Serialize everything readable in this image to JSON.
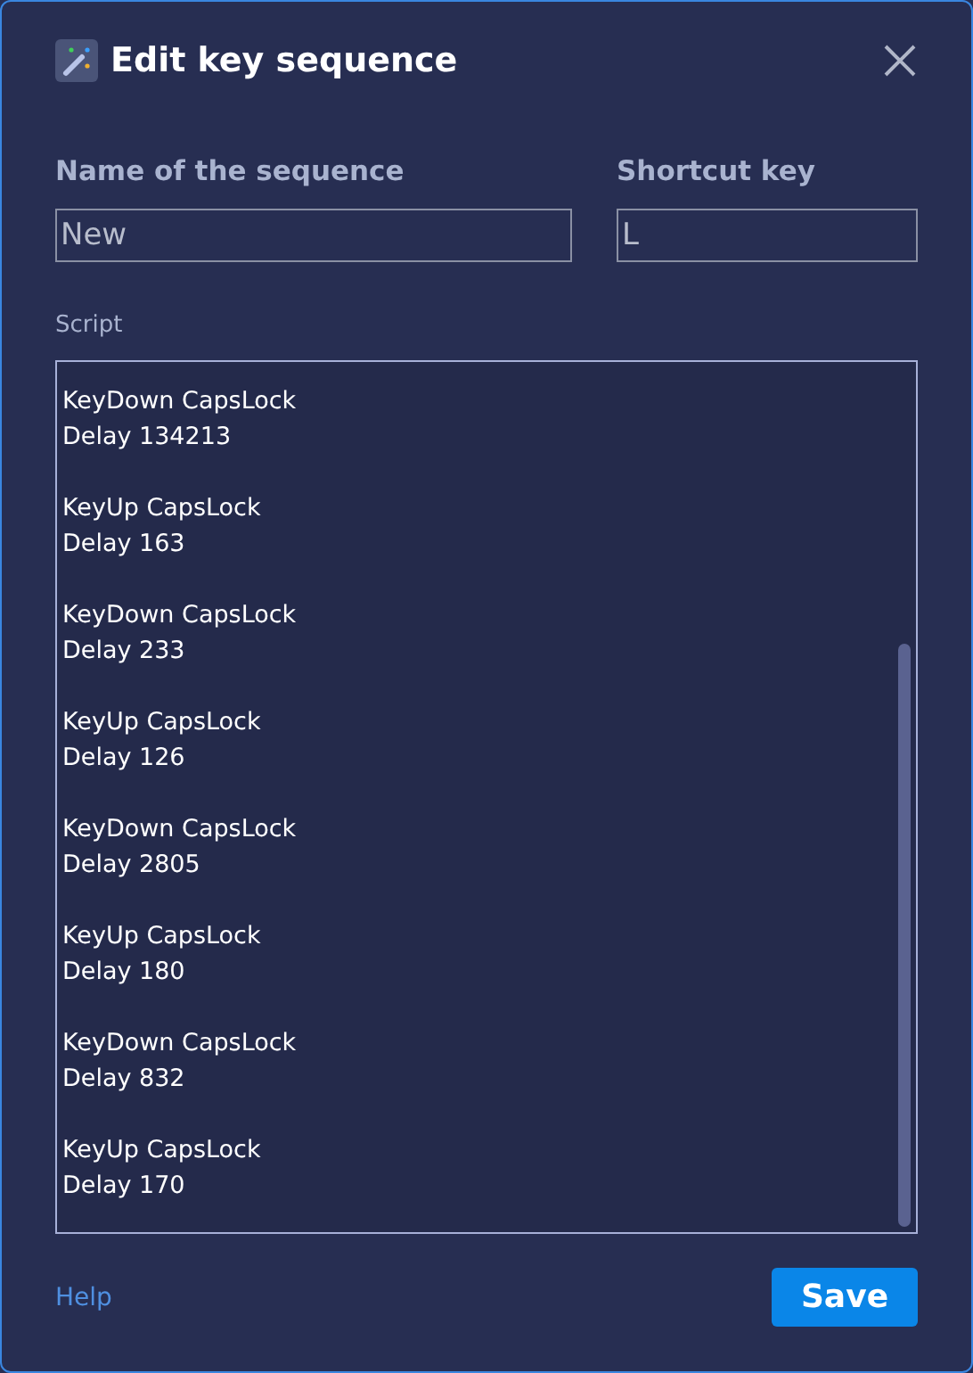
{
  "dialog": {
    "title": "Edit key sequence"
  },
  "name_field": {
    "label": "Name of the sequence",
    "value": "New"
  },
  "shortcut_field": {
    "label": "Shortcut key",
    "value": "L"
  },
  "script": {
    "label": "Script",
    "entries": [
      {
        "event": "KeyDown CapsLock",
        "delay": "Delay 134213"
      },
      {
        "event": "KeyUp CapsLock",
        "delay": "Delay 163"
      },
      {
        "event": "KeyDown CapsLock",
        "delay": "Delay 233"
      },
      {
        "event": "KeyUp CapsLock",
        "delay": "Delay 126"
      },
      {
        "event": "KeyDown CapsLock",
        "delay": "Delay 2805"
      },
      {
        "event": "KeyUp CapsLock",
        "delay": "Delay 180"
      },
      {
        "event": "KeyDown CapsLock",
        "delay": "Delay 832"
      },
      {
        "event": "KeyUp CapsLock",
        "delay": "Delay 170"
      }
    ]
  },
  "help_link": "Help",
  "save_button": "Save"
}
